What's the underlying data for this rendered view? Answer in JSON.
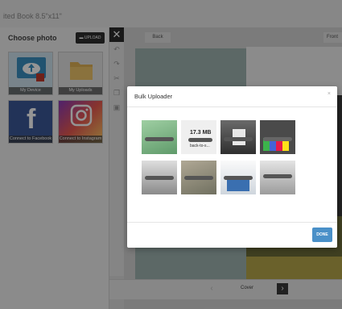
{
  "window": {
    "title": "ited Book 8.5\"x11\""
  },
  "left_panel": {
    "heading": "Choose photo",
    "upload_label": "UPLOAD",
    "sources": [
      {
        "label": "My Device",
        "icon": "cloud-upload-icon"
      },
      {
        "label": "My Uploads",
        "icon": "folder-icon"
      },
      {
        "label": "Connect to Facebook",
        "icon": "facebook-icon"
      },
      {
        "label": "Connect to Instagram",
        "icon": "instagram-icon"
      }
    ]
  },
  "toolbar": {
    "close_label": "✕"
  },
  "editor": {
    "back_label": "Back",
    "front_label": "Front",
    "page_label": "Cover"
  },
  "modal": {
    "title": "Bulk Uploader",
    "close_label": "×",
    "upload_item": {
      "size": "17.3 MB",
      "filename": "back-to-s..."
    },
    "done_label": "DONE"
  },
  "colors": {
    "accent": "#4a90c8",
    "dark_button": "#2f2f2f",
    "teal_page": "#9fb4b0"
  }
}
